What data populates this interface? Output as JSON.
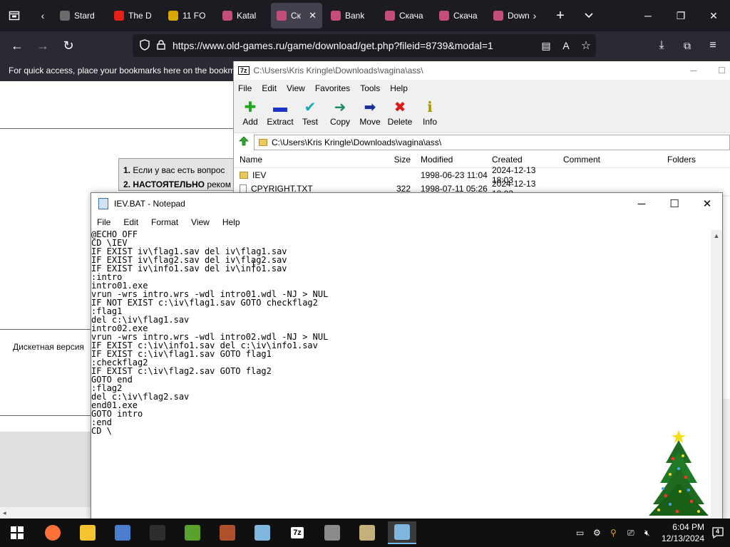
{
  "browser": {
    "tabs": [
      {
        "title": "Stard",
        "favicon_color": "#6b6b6b",
        "active": false
      },
      {
        "title": "The D",
        "favicon_color": "#e62117",
        "active": false
      },
      {
        "title": "11 FO",
        "favicon_color": "#d8a800",
        "active": false
      },
      {
        "title": "Katal",
        "favicon_color": "#c44d7a",
        "active": false
      },
      {
        "title": "Ск",
        "favicon_color": "#c44d7a",
        "active": true
      },
      {
        "title": "Bank",
        "favicon_color": "#c44d7a",
        "active": false
      },
      {
        "title": "Скача",
        "favicon_color": "#c44d7a",
        "active": false
      },
      {
        "title": "Скача",
        "favicon_color": "#c44d7a",
        "active": false
      },
      {
        "title": "Down",
        "favicon_color": "#c44d7a",
        "active": false
      }
    ],
    "url": "https://www.old-games.ru/game/download/get.php?fileid=8739&modal=1",
    "bookmarks_hint": "For quick access, place your bookmarks here on the bookm"
  },
  "webpage": {
    "notice_line1_num": "1.",
    "notice_line1": "Если у вас есть вопрос",
    "notice_line2_num": "2.",
    "notice_line2_bold": "НАСТОЯТЕЛЬНО",
    "notice_line2": "реком",
    "diskette": "Дискетная версия"
  },
  "sevenzip": {
    "title": "C:\\Users\\Kris Kringle\\Downloads\\vagina\\ass\\",
    "menu": [
      "File",
      "Edit",
      "View",
      "Favorites",
      "Tools",
      "Help"
    ],
    "tools": [
      {
        "label": "Add",
        "icon": "plus-icon",
        "color": "#1fa81f"
      },
      {
        "label": "Extract",
        "icon": "minus-icon",
        "color": "#1a35c8"
      },
      {
        "label": "Test",
        "icon": "check-icon",
        "color": "#14a8b8"
      },
      {
        "label": "Copy",
        "icon": "copy-arrow-icon",
        "color": "#1d8a6a"
      },
      {
        "label": "Move",
        "icon": "move-arrow-icon",
        "color": "#1a2f9a"
      },
      {
        "label": "Delete",
        "icon": "delete-x-icon",
        "color": "#d81b1b"
      },
      {
        "label": "Info",
        "icon": "info-icon",
        "color": "#a89800"
      }
    ],
    "path": "C:\\Users\\Kris Kringle\\Downloads\\vagina\\ass\\",
    "columns": [
      "Name",
      "Size",
      "Modified",
      "Created",
      "Comment",
      "Folders"
    ],
    "rows": [
      {
        "name": "IEV",
        "type": "folder",
        "size": "",
        "modified": "1998-06-23 11:04",
        "created": "2024-12-13 18:03"
      },
      {
        "name": "CPYRIGHT.TXT",
        "type": "file",
        "size": "322",
        "modified": "1998-07-11 05:26",
        "created": "2024-12-13 18:03"
      }
    ]
  },
  "notepad": {
    "title": "IEV.BAT - Notepad",
    "menu": [
      "File",
      "Edit",
      "Format",
      "View",
      "Help"
    ],
    "content": "@ECHO OFF\nCD \\IEV\nIF EXIST iv\\flag1.sav del iv\\flag1.sav\nIF EXIST iv\\flag2.sav del iv\\flag2.sav\nIF EXIST iv\\info1.sav del iv\\info1.sav\n:intro\nintro01.exe\nvrun -wrs intro.wrs -wdl intro01.wdl -NJ > NUL\nIF NOT EXIST c:\\iv\\flag1.sav GOTO checkflag2\n:flag1\ndel c:\\iv\\flag1.sav\nintro02.exe\nvrun -wrs intro.wrs -wdl intro02.wdl -NJ > NUL\nIF EXIST c:\\iv\\info1.sav del c:\\iv\\info1.sav\nIF EXIST c:\\iv\\flag1.sav GOTO flag1\n:checkflag2\nIF EXIST c:\\iv\\flag2.sav GOTO flag2\nGOTO end\n:flag2\ndel c:\\iv\\flag2.sav\nend01.exe\nGOTO intro\n:end\nCD \\"
  },
  "taskbar": {
    "apps": [
      {
        "name": "firefox",
        "color": "#ff7139"
      },
      {
        "name": "file-explorer",
        "color": "#f4c430"
      },
      {
        "name": "app-blue",
        "color": "#4a7fd0"
      },
      {
        "name": "security",
        "color": "#2d2d2d"
      },
      {
        "name": "app-green",
        "color": "#5aa02c"
      },
      {
        "name": "app-game",
        "color": "#b0502a"
      },
      {
        "name": "app-notepad",
        "color": "#7fb6e0"
      },
      {
        "name": "7zip",
        "color": "#222222"
      },
      {
        "name": "app-gray",
        "color": "#8a8a8a"
      },
      {
        "name": "paint",
        "color": "#c4b07a"
      },
      {
        "name": "notepad-active",
        "color": "#7fb6e0"
      }
    ],
    "time": "6:04 PM",
    "date": "12/13/2024",
    "notifications": "4",
    "sevenzip_label": "7z"
  }
}
